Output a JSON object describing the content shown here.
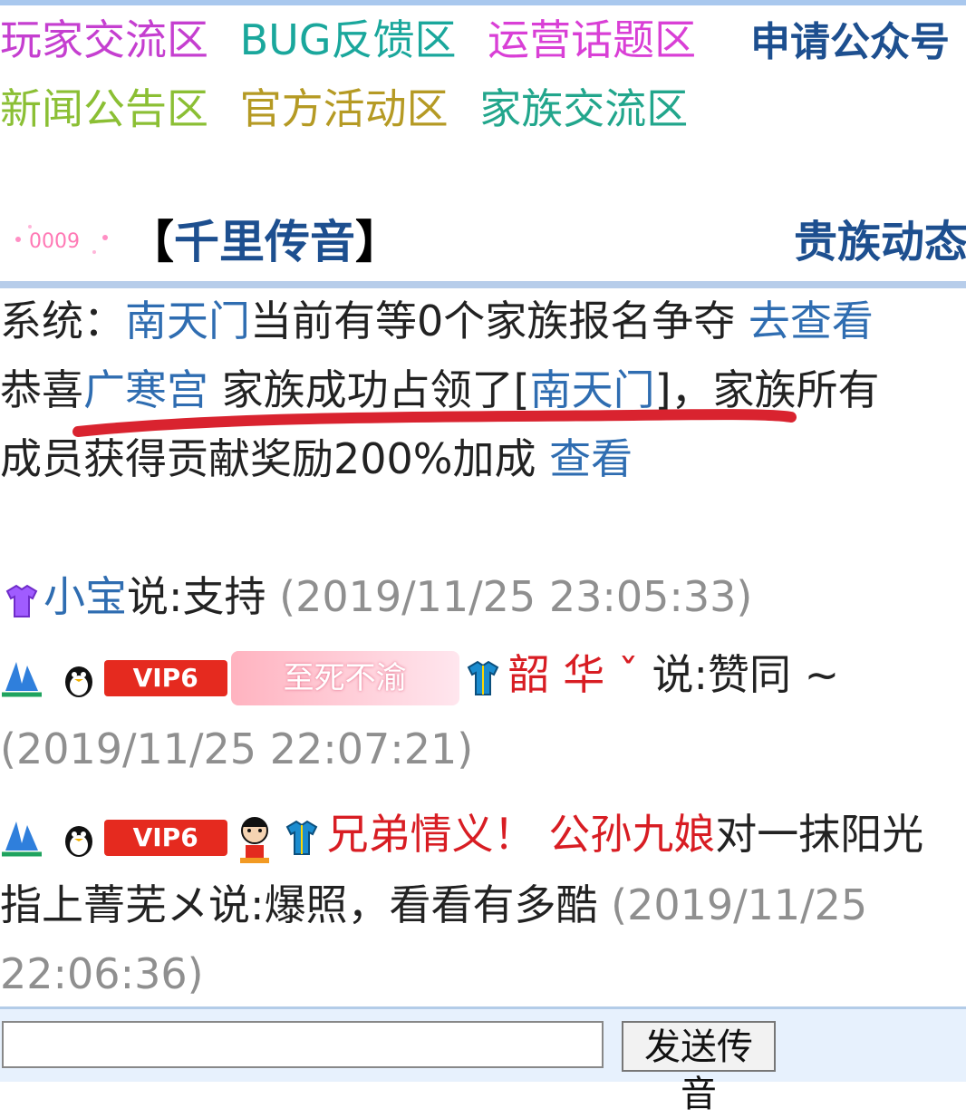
{
  "nav": {
    "row1": [
      {
        "label": "玩家交流区",
        "color": "#c53fd0"
      },
      {
        "label": "BUG反馈区",
        "color": "#1aa79c"
      },
      {
        "label": "运营话题区",
        "color": "#d93fd6"
      }
    ],
    "apply_label": "申请公众号",
    "row2": [
      {
        "label": "新闻公告区",
        "color": "#8bbf34"
      },
      {
        "label": "官方活动区",
        "color": "#b59a24"
      },
      {
        "label": "家族交流区",
        "color": "#22a68c"
      }
    ]
  },
  "bar": {
    "deco_label": "0009",
    "title_open": "【",
    "title": "千里传音",
    "title_close": "】",
    "right": "贵族动态"
  },
  "system": {
    "prefix": "系统：",
    "place": "南天门",
    "middle": "当前有等0个家族报名争夺",
    "action": "去查看"
  },
  "congrats": {
    "prefix": "恭喜",
    "family": "广寒宫",
    "middle": " 家族成功占领了[",
    "place": "南天门",
    "suffix": "]，家族所有",
    "line2": "成员获得贡献奖励200%加成",
    "action": "查看"
  },
  "messages": [
    {
      "user": "小宝",
      "text": "说:支持",
      "time": "(2019/11/25 23:05:33)"
    },
    {
      "vip": "VIP6",
      "badge": "至死不渝",
      "user": "韶 华 ˇ",
      "text": " 说:赞同 ~",
      "time": "(2019/11/25 22:07:21)"
    },
    {
      "vip": "VIP6",
      "user": "兄弟情义！ 公孙九娘",
      "text_part1": "对一抹阳光",
      "text_part2": "指上菁芜メ说:爆照，看看有多酷",
      "time_part1": "(2019/11/25",
      "time_part2": "22:06:36)"
    }
  ],
  "footer": {
    "input_value": "",
    "send_label": "发送传音"
  }
}
